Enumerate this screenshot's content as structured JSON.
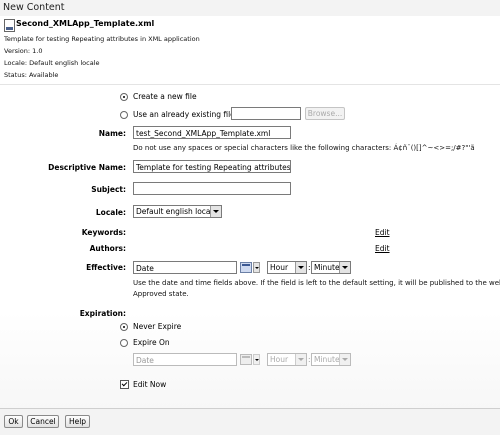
{
  "window": {
    "title": "New Content"
  },
  "template": {
    "name": "Second_XMLApp_Template.xml",
    "description": "Template for testing Repeating attributes in XML application",
    "version": "Version: 1.0",
    "locale": "Locale: Default english locale",
    "status": "Status: Available"
  },
  "source": {
    "create_label": "Create a new file",
    "use_existing_label": "Use an already existing file:",
    "existing_value": "",
    "browse_label": "Browse..."
  },
  "fields": {
    "name_label": "Name:",
    "name_value": "test_Second_XMLApp_Template.xml",
    "name_note": "Do not use any spaces or special characters like the following characters: Á¢ñ¨()[]^~<>=;/#?\"'ã",
    "desc_label": "Descriptive Name:",
    "desc_value": "Template for testing Repeating attributes in",
    "subject_label": "Subject:",
    "subject_value": "",
    "locale_label": "Locale:",
    "locale_value": "Default english locale",
    "keywords_label": "Keywords:",
    "keywords_edit": "Edit",
    "authors_label": "Authors:",
    "authors_edit": "Edit"
  },
  "effective": {
    "label": "Effective:",
    "date_placeholder": "Date",
    "hour": "Hour",
    "minute": "Minute",
    "separator": ":",
    "note_line1": "Use the date and time fields above. If the field is left to the default setting, it will be published to the web",
    "note_line2": "Approved state."
  },
  "expiration": {
    "label": "Expiration:",
    "never_label": "Never Expire",
    "on_label": "Expire On",
    "date_placeholder": "Date",
    "hour": "Hour",
    "minute": "Minute",
    "separator": ":"
  },
  "edit_now": {
    "label": "Edit Now",
    "checked": true
  },
  "buttons": {
    "ok": "Ok",
    "cancel": "Cancel",
    "help": "Help"
  }
}
